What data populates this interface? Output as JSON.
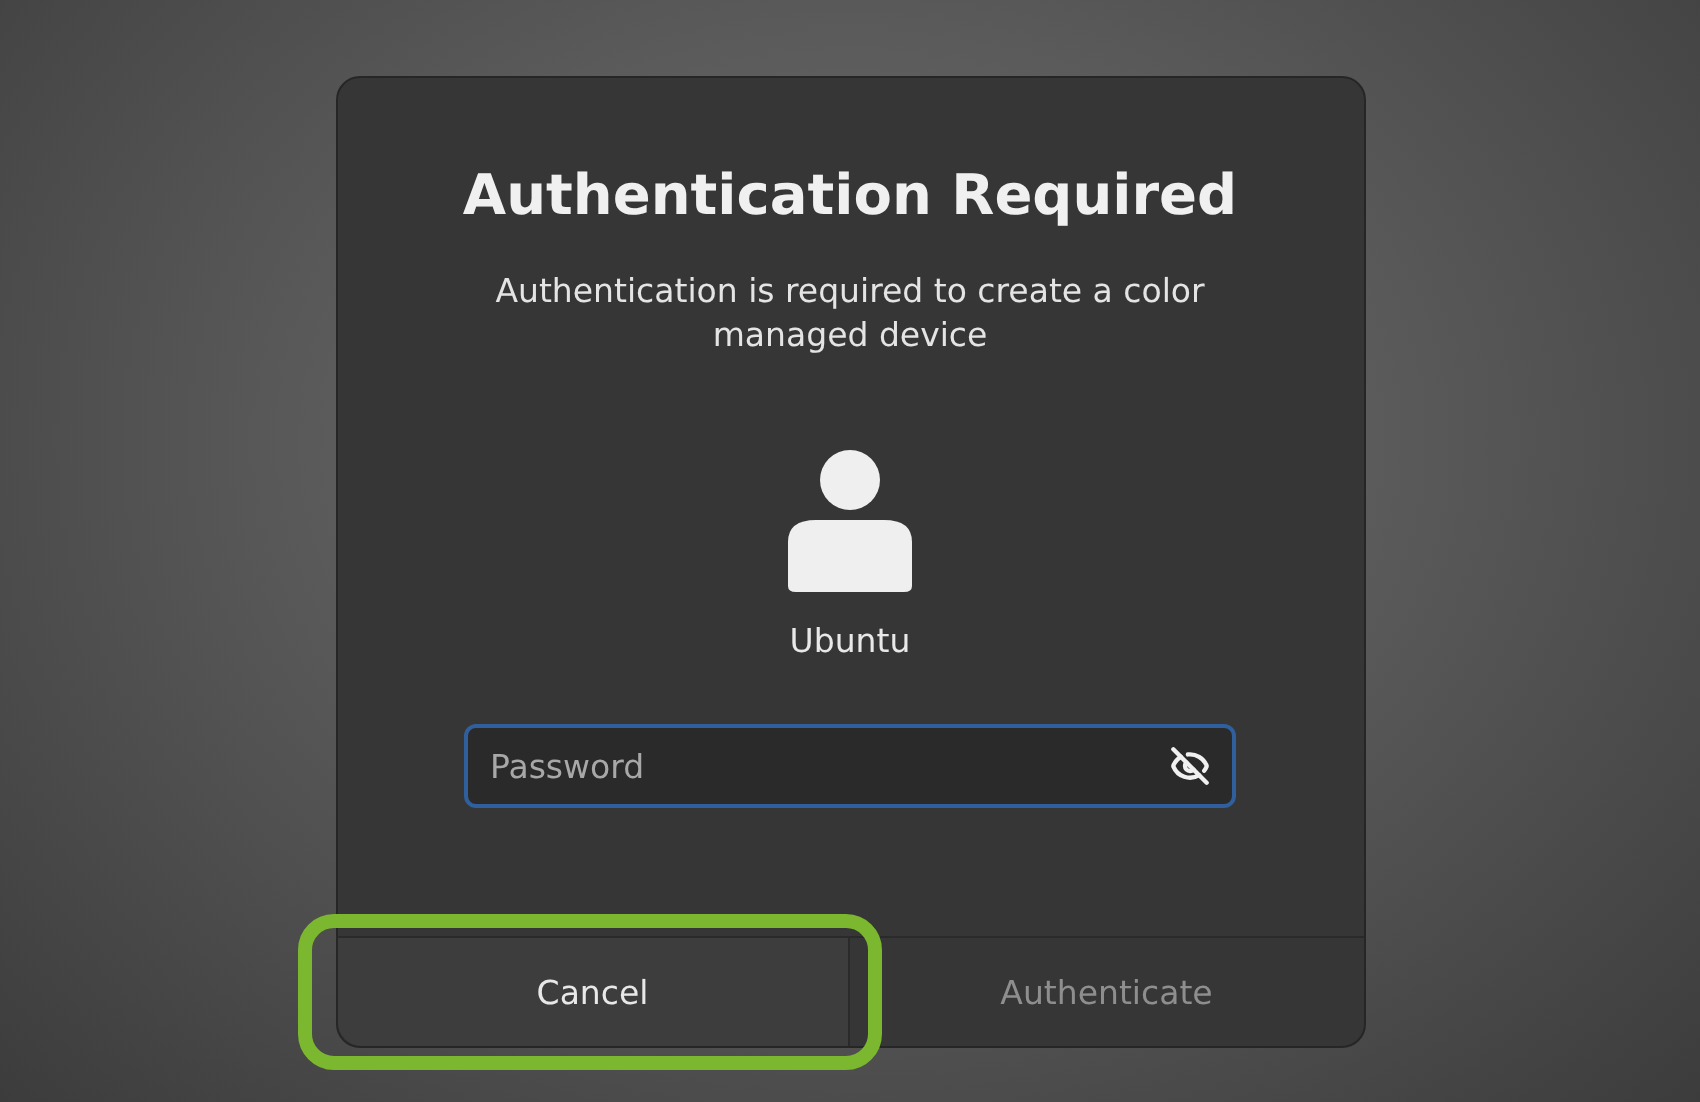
{
  "dialog": {
    "title": "Authentication Required",
    "message": "Authentication is required to create a color managed device",
    "user": {
      "name": "Ubuntu"
    },
    "password": {
      "placeholder": "Password",
      "focused": true
    },
    "buttons": [
      {
        "label": "Cancel",
        "disabled": false,
        "highlighted": true
      },
      {
        "label": "Authenticate",
        "disabled": true,
        "highlighted": false
      }
    ]
  }
}
